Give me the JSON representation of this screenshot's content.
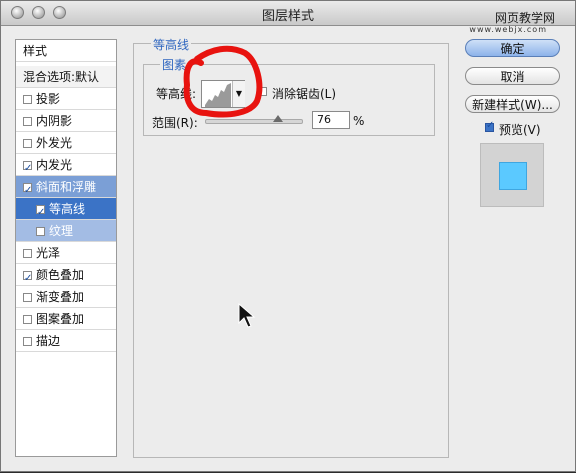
{
  "window": {
    "title": "图层样式",
    "watermark_line1": "网页教学网",
    "watermark_line2": "www.webjx.com"
  },
  "styles_panel": {
    "header": "样式",
    "blend_options": "混合选项:默认",
    "items": [
      {
        "label": "投影",
        "checked": false
      },
      {
        "label": "内阴影",
        "checked": false
      },
      {
        "label": "外发光",
        "checked": false
      },
      {
        "label": "内发光",
        "checked": true
      },
      {
        "label": "斜面和浮雕",
        "checked": true,
        "selected": true
      },
      {
        "label": "等高线",
        "checked": true,
        "sub": true,
        "active": true
      },
      {
        "label": "纹理",
        "checked": false,
        "sub": true
      },
      {
        "label": "光泽",
        "checked": false
      },
      {
        "label": "颜色叠加",
        "checked": true
      },
      {
        "label": "渐变叠加",
        "checked": false
      },
      {
        "label": "图案叠加",
        "checked": false
      },
      {
        "label": "描边",
        "checked": false
      }
    ]
  },
  "contour_section": {
    "group_title": "等高线",
    "subgroup_title": "图素",
    "contour_label": "等高线:",
    "anti_alias_label": "消除锯齿(L)",
    "range_label": "范围(R):",
    "range_value": "76",
    "range_unit": "%",
    "range_fraction": 0.76
  },
  "buttons": {
    "ok": "确定",
    "cancel": "取消",
    "new_style": "新建样式(W)...",
    "preview_label": "预览(V)"
  },
  "colors": {
    "preview_fill": "#5bc9ff",
    "selection": "#3b73c6",
    "annotation": "#e8130f"
  }
}
